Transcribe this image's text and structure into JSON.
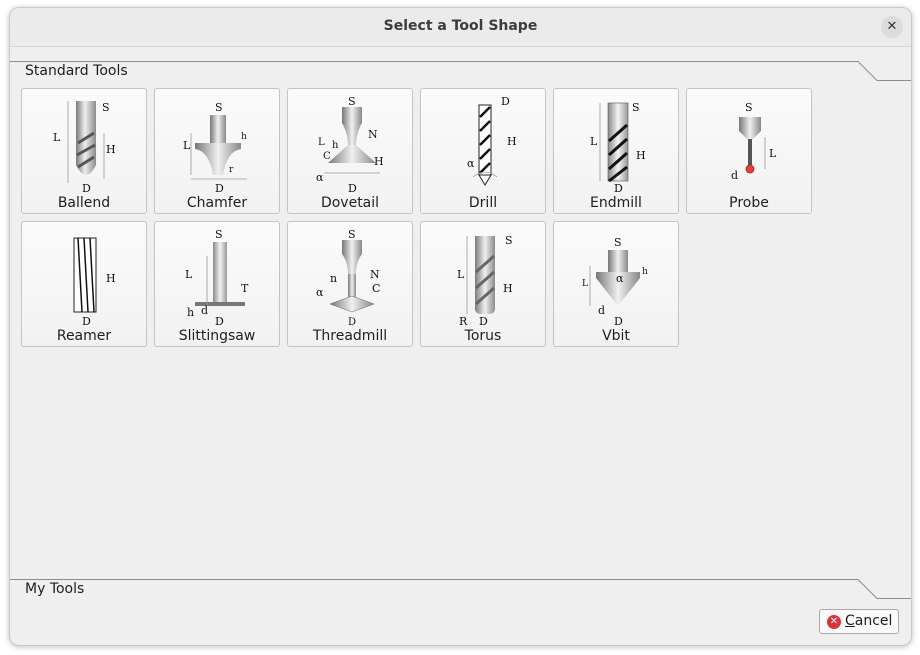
{
  "dialog": {
    "title": "Select a Tool Shape",
    "close_glyph": "✕"
  },
  "sections": {
    "standard_title": "Standard Tools",
    "my_tools_title": "My Tools"
  },
  "tools": [
    {
      "label": "Ballend",
      "dims": [
        "S",
        "L",
        "H",
        "D"
      ]
    },
    {
      "label": "Chamfer",
      "dims": [
        "S",
        "L",
        "h",
        "r",
        "D"
      ]
    },
    {
      "label": "Dovetail",
      "dims": [
        "S",
        "N",
        "L",
        "h",
        "C",
        "H",
        "α",
        "D"
      ]
    },
    {
      "label": "Drill",
      "dims": [
        "D",
        "H",
        "α"
      ]
    },
    {
      "label": "Endmill",
      "dims": [
        "S",
        "L",
        "H",
        "D"
      ]
    },
    {
      "label": "Probe",
      "dims": [
        "S",
        "L",
        "d"
      ]
    },
    {
      "label": "Reamer",
      "dims": [
        "H",
        "D"
      ]
    },
    {
      "label": "Slittingsaw",
      "dims": [
        "S",
        "L",
        "T",
        "h",
        "d",
        "D"
      ]
    },
    {
      "label": "Threadmill",
      "dims": [
        "S",
        "N",
        "n",
        "α",
        "C",
        "D"
      ]
    },
    {
      "label": "Torus",
      "dims": [
        "S",
        "L",
        "H",
        "R",
        "D"
      ]
    },
    {
      "label": "Vbit",
      "dims": [
        "S",
        "L",
        "α",
        "h",
        "d",
        "D"
      ]
    }
  ],
  "footer": {
    "cancel_mnemonic": "C",
    "cancel_rest": "ancel",
    "cancel_icon": "cancel-icon"
  }
}
